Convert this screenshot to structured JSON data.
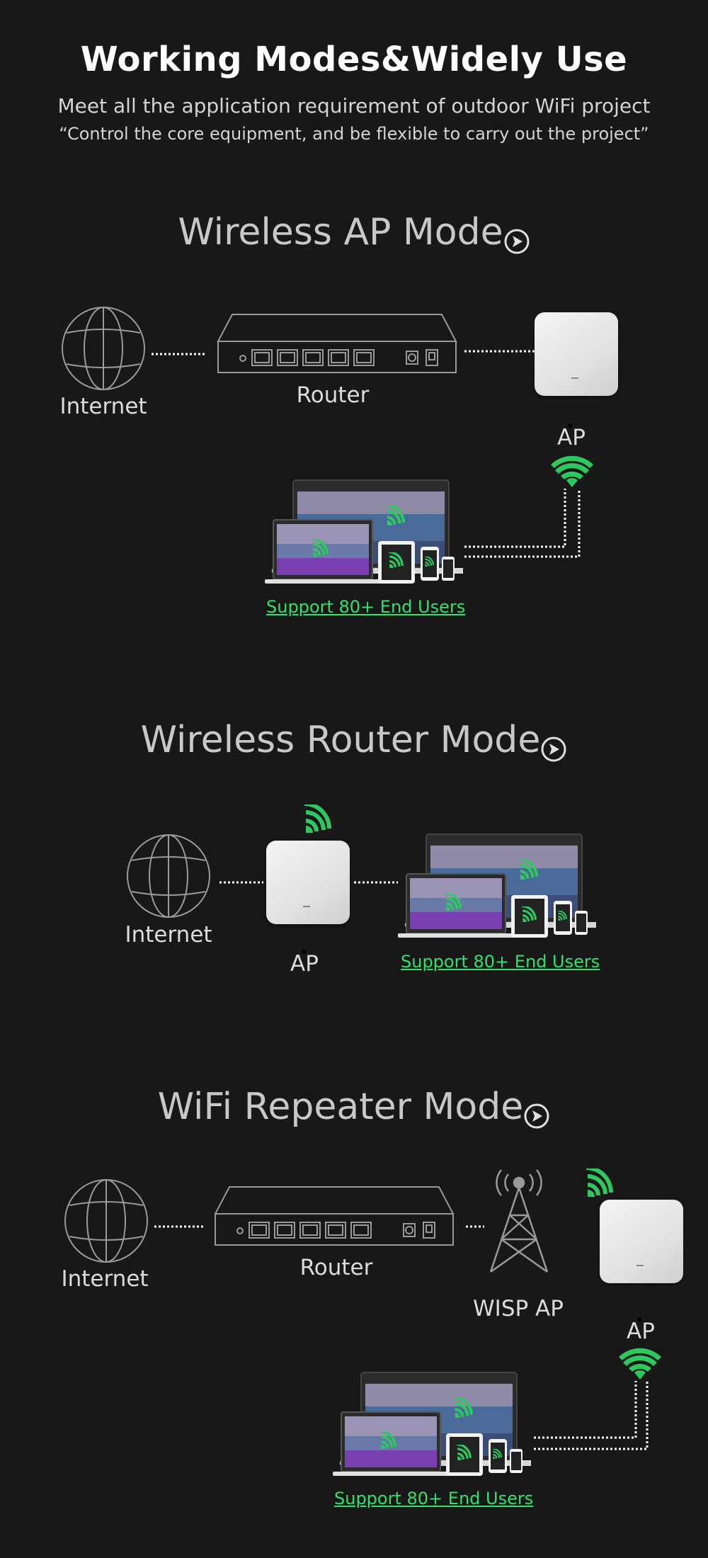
{
  "header": {
    "title": "Working Modes&Widely Use",
    "subtitle": "Meet all the application requirement of outdoor WiFi project",
    "quote": "“Control the core equipment, and be flexible to carry out the project”"
  },
  "colors": {
    "background": "#181818",
    "accent": "#2ee26c",
    "text": "#d8d8d8"
  },
  "modes": [
    {
      "title": "Wireless AP Mode",
      "labels": {
        "internet": "Internet",
        "router": "Router",
        "ap": "AP",
        "users": "Support 80+ End Users"
      }
    },
    {
      "title": "Wireless Router Mode",
      "labels": {
        "internet": "Internet",
        "ap": "AP",
        "users": "Support 80+ End Users"
      }
    },
    {
      "title": "WiFi Repeater Mode",
      "labels": {
        "internet": "Internet",
        "router": "Router",
        "wisp": "WISP AP",
        "ap": "AP",
        "users": "Support 80+ End Users"
      }
    }
  ],
  "icons": [
    "globe-icon",
    "router-icon",
    "access-point-icon",
    "wifi-signal-icon",
    "devices-icon",
    "tower-icon",
    "arrow-circle-icon"
  ]
}
